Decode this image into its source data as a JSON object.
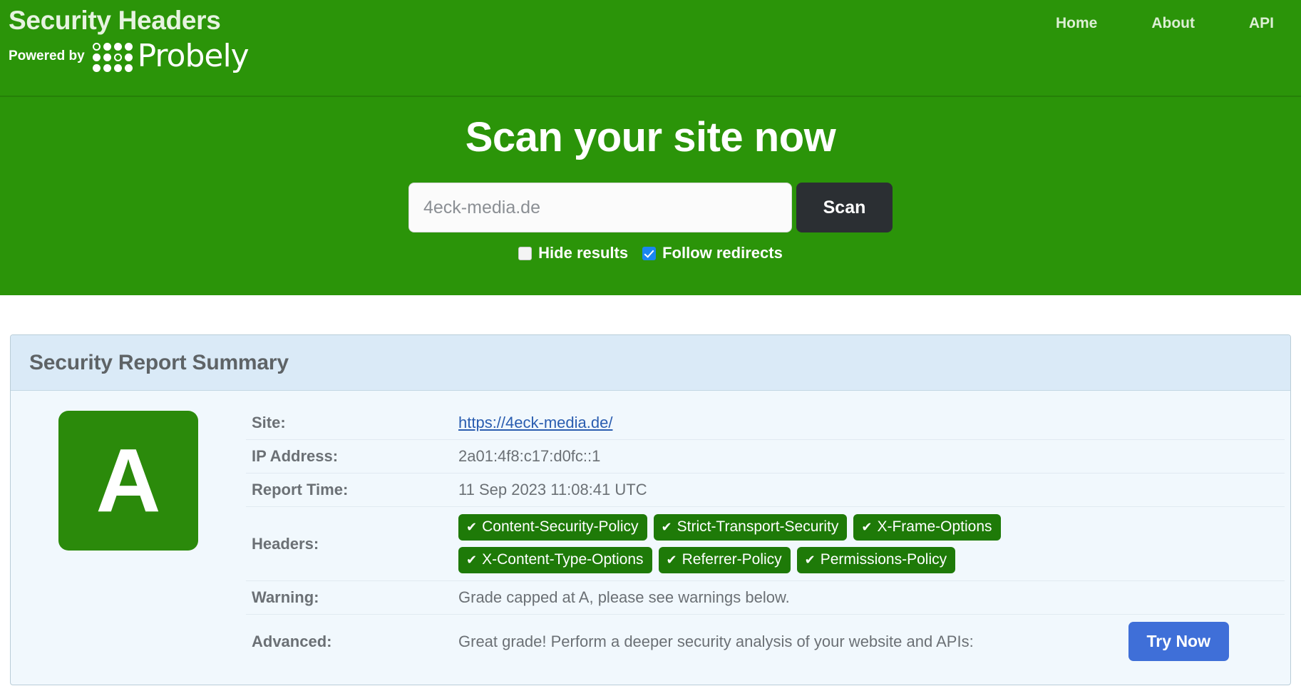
{
  "header": {
    "brand_title": "Security Headers",
    "powered_by": "Powered by",
    "probely_word": "Probely",
    "nav": [
      {
        "label": "Home"
      },
      {
        "label": "About"
      },
      {
        "label": "API"
      }
    ]
  },
  "hero": {
    "title": "Scan your site now",
    "input_value": "4eck-media.de",
    "input_placeholder": "4eck-media.de",
    "scan_label": "Scan",
    "options": [
      {
        "label": "Hide results",
        "checked": false
      },
      {
        "label": "Follow redirects",
        "checked": true
      }
    ]
  },
  "report": {
    "panel_title": "Security Report Summary",
    "grade": "A",
    "grade_color": "#2b8a0b",
    "rows": {
      "site_key": "Site:",
      "site_value": "https://4eck-media.de/",
      "ip_key": "IP Address:",
      "ip_value": "2a01:4f8:c17:d0fc::1",
      "time_key": "Report Time:",
      "time_value": "11 Sep 2023 11:08:41 UTC",
      "headers_key": "Headers:",
      "warning_key": "Warning:",
      "warning_value": "Grade capped at A, please see warnings below.",
      "advanced_key": "Advanced:",
      "advanced_value": "Great grade! Perform a deeper security analysis of your website and APIs:",
      "try_now_label": "Try Now"
    },
    "headers": [
      {
        "name": "Content-Security-Policy",
        "status": "present"
      },
      {
        "name": "Strict-Transport-Security",
        "status": "present"
      },
      {
        "name": "X-Frame-Options",
        "status": "present"
      },
      {
        "name": "X-Content-Type-Options",
        "status": "present"
      },
      {
        "name": "Referrer-Policy",
        "status": "present"
      },
      {
        "name": "Permissions-Policy",
        "status": "present"
      }
    ],
    "check_glyph": "✔"
  },
  "colors": {
    "brand_green": "#2b9409",
    "badge_green": "#1e7a08",
    "accent_blue": "#3f6fd8",
    "checkbox_blue": "#1a86f0",
    "panel_head": "#daeaf7",
    "panel_body": "#f1f8fd"
  }
}
